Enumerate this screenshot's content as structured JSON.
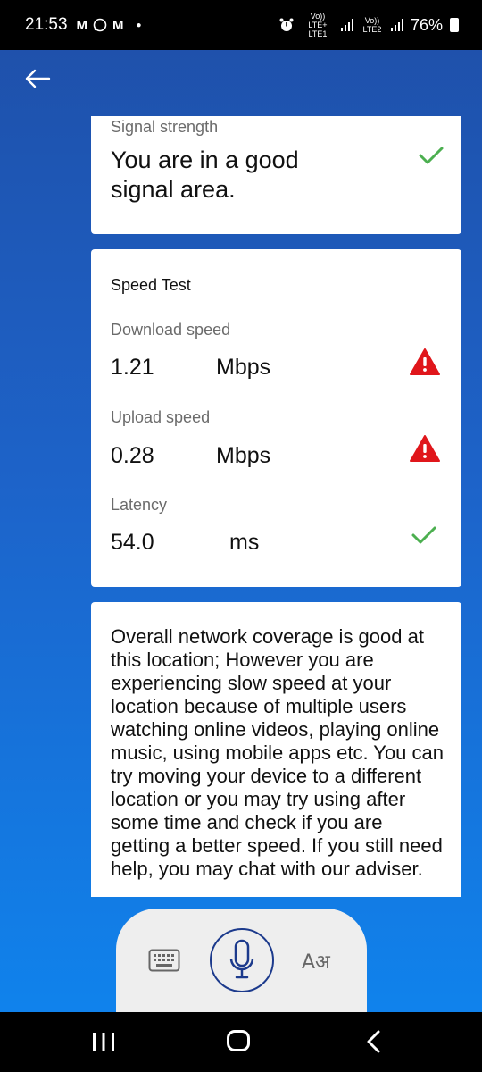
{
  "status_bar": {
    "time": "21:53",
    "notification_icons": [
      "gmail-icon",
      "whatsapp-icon",
      "gmail-icon"
    ],
    "network1": "Vo)) LTE+ LTE1",
    "network2": "Vo)) LTE2",
    "battery": "76%"
  },
  "signal_card": {
    "label": "Signal strength",
    "message": "You are in a good signal area.",
    "status_icon": "check-icon"
  },
  "speed_test": {
    "title": "Speed Test",
    "download": {
      "label": "Download speed",
      "value": "1.21",
      "unit": "Mbps",
      "status_icon": "warning-icon"
    },
    "upload": {
      "label": "Upload speed",
      "value": "0.28",
      "unit": "Mbps",
      "status_icon": "warning-icon"
    },
    "latency": {
      "label": "Latency",
      "value": "54.0",
      "unit": "ms",
      "status_icon": "check-icon"
    }
  },
  "info": {
    "text": "Overall network coverage is good at this location; However you are experiencing slow speed at your location because of multiple users watching online videos, playing online music, using mobile apps etc. You can try moving your device to a different location or you may try using after some time and check if you are getting a better speed. If you still need help, you may chat with our adviser."
  },
  "input_panel": {
    "keyboard_icon": "keyboard-icon",
    "mic_icon": "microphone-icon",
    "language_label": "Aअ"
  },
  "colors": {
    "gradient_top": "#1f4fa8",
    "gradient_bottom": "#0e86f0",
    "check_green": "#4caf50",
    "warning_red": "#e0161b",
    "mic_blue": "#1c3a8c"
  }
}
